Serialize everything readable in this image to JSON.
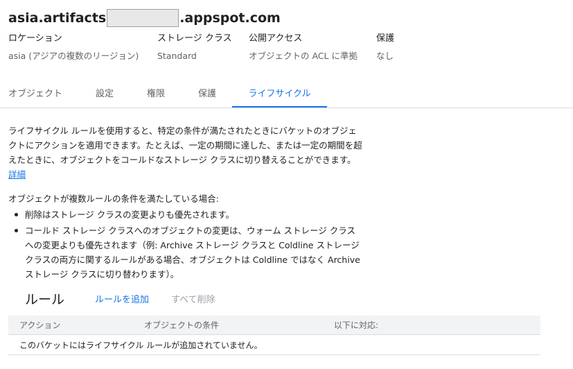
{
  "bucket": {
    "name_prefix": "asia.artifacts",
    "name_suffix": ".appspot.com"
  },
  "info": [
    {
      "label": "ロケーション",
      "value": "asia (アジアの複数のリージョン)"
    },
    {
      "label": "ストレージ クラス",
      "value": "Standard"
    },
    {
      "label": "公開アクセス",
      "value": "オブジェクトの ACL に準拠"
    },
    {
      "label": "保護",
      "value": "なし"
    }
  ],
  "tabs": [
    {
      "label": "オブジェクト",
      "active": false
    },
    {
      "label": "設定",
      "active": false
    },
    {
      "label": "権限",
      "active": false
    },
    {
      "label": "保護",
      "active": false
    },
    {
      "label": "ライフサイクル",
      "active": true
    }
  ],
  "lifecycle": {
    "description": "ライフサイクル ルールを使用すると、特定の条件が満たされたときにバケットのオブジェクトにアクションを適用できます。たとえば、一定の期間に達した、または一定の期間を超えたときに、オブジェクトをコールドなストレージ クラスに切り替えることができます。",
    "learn_more": "詳細",
    "priority_intro": "オブジェクトが複数ルールの条件を満たしている場合:",
    "priority_items": [
      "削除はストレージ クラスの変更よりも優先されます。",
      "コールド ストレージ クラスへのオブジェクトの変更は、ウォーム ストレージ クラスへの変更よりも優先されます（例: Archive ストレージ クラスと Coldline ストレージ クラスの両方に関するルールがある場合、オブジェクトは Coldline ではなく Archive ストレージ クラスに切り替わります）。"
    ]
  },
  "rules": {
    "title": "ルール",
    "add_label": "ルールを追加",
    "delete_all_label": "すべて削除",
    "columns": [
      "アクション",
      "オブジェクトの条件",
      "以下に対応:"
    ],
    "empty_message": "このバケットにはライフサイクル ルールが追加されていません。"
  },
  "colors": {
    "accent": "#1a73e8",
    "text": "#202124",
    "secondary_text": "#5f6368",
    "disabled_text": "#9aa0a6",
    "divider": "#dadce0",
    "table_header_bg": "#f1f3f4"
  }
}
